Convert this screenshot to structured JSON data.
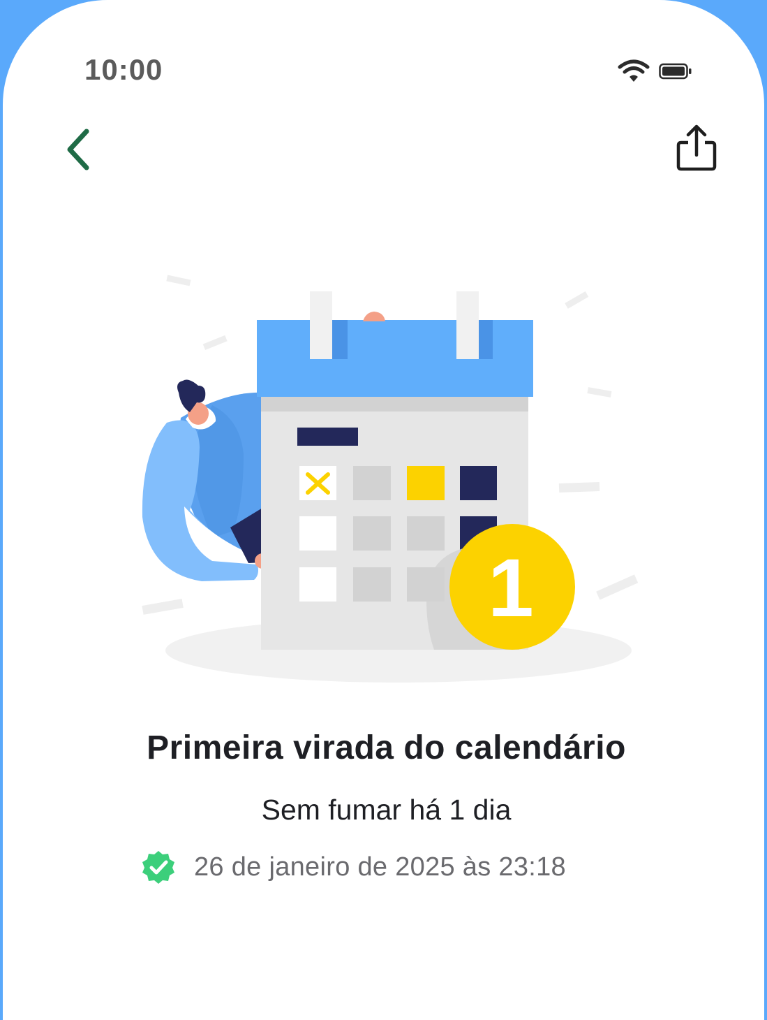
{
  "status_bar": {
    "time": "10:00"
  },
  "header": {
    "back_icon": "chevron-left-icon",
    "share_icon": "share-icon",
    "back_color": "#1f6b46"
  },
  "illustration": {
    "badge_number": "1"
  },
  "achievement": {
    "title": "Primeira virada do calendário",
    "subtitle": "Sem fumar há 1 dia",
    "date": "26 de janeiro de 2025 às 23:18",
    "verified_color": "#3ccf7b"
  }
}
